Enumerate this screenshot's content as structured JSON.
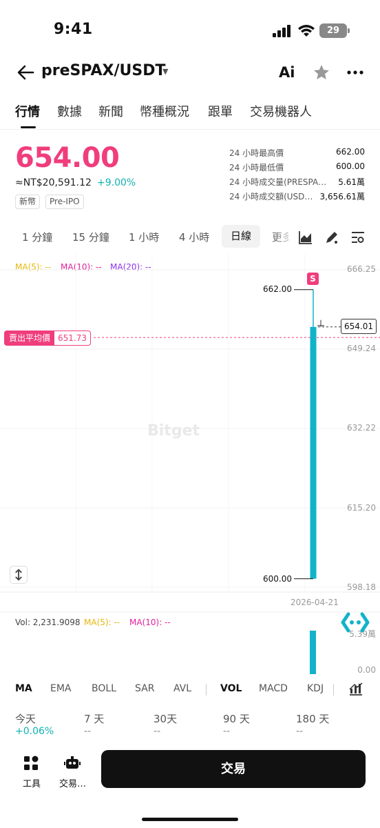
{
  "status": {
    "time": "9:41",
    "battery": "29"
  },
  "header": {
    "title": "preSPAX/USDT",
    "ai_label": "Ai"
  },
  "tabs": [
    "行情",
    "數據",
    "新聞",
    "幣種概況",
    "跟單",
    "交易機器人"
  ],
  "price": {
    "last": "654.00",
    "fiat": "≈NT$20,591.12",
    "change": "+9.00%",
    "tags": [
      "新幣",
      "Pre-IPO"
    ]
  },
  "stats": [
    {
      "label": "24 小時最高價",
      "value": "662.00"
    },
    {
      "label": "24 小時最低價",
      "value": "600.00"
    },
    {
      "label": "24 小時成交量(PRESPA…",
      "value": "5.61萬"
    },
    {
      "label": "24 小時成交額(USD…",
      "value": "3,656.61萬"
    }
  ],
  "timeframes": [
    "1 分鐘",
    "15 分鐘",
    "1 小時",
    "4 小時"
  ],
  "timeframe_active": "日線",
  "timeframe_more": "更多",
  "ma_legend": {
    "ma5": "MA(5): --",
    "ma10": "MA(10): --",
    "ma20": "MA(20): --"
  },
  "chart": {
    "axis_labels": [
      "666.25",
      "649.24",
      "632.22",
      "615.20",
      "598.18"
    ],
    "high_label": "662.00",
    "low_label": "600.00",
    "last_price_box": "654.01",
    "sell_avg_label": "賣出平均價",
    "sell_avg_value": "651.73",
    "signal_marker": "S",
    "watermark": "Bitget",
    "date": "2026-04-21"
  },
  "chart_data": {
    "type": "candlestick",
    "x": [
      "2026-04-21"
    ],
    "open": [
      600.0
    ],
    "high": [
      662.0
    ],
    "low": [
      600.0
    ],
    "close": [
      654.0
    ],
    "ylim": [
      598.18,
      666.25
    ],
    "y_ticks": [
      666.25,
      649.24,
      632.22,
      615.2,
      598.18
    ],
    "reference_lines": [
      {
        "name": "賣出平均價",
        "value": 651.73
      },
      {
        "name": "last",
        "value": 654.01
      }
    ],
    "volume": {
      "values": [
        56100
      ],
      "ylim": [
        0,
        53900
      ],
      "y_ticks": [
        "5.39萬",
        "0.00"
      ]
    },
    "colors": {
      "up": "#12b3c8",
      "sell_line": "#f03d7c"
    }
  },
  "volume": {
    "legend": "Vol: 2,231.9098",
    "ma5": "MA(5): --",
    "ma10": "MA(10): --",
    "axis_top": "5.39萬",
    "axis_bottom": "0.00"
  },
  "indicators": [
    "MA",
    "EMA",
    "BOLL",
    "SAR",
    "AVL",
    "VOL",
    "MACD",
    "KDJ"
  ],
  "performance": [
    {
      "label": "今天",
      "value": "+0.06%"
    },
    {
      "label": "7 天",
      "value": "--"
    },
    {
      "label": "30天",
      "value": "--"
    },
    {
      "label": "90 天",
      "value": "--"
    },
    {
      "label": "180 天",
      "value": "--"
    }
  ],
  "bottom": {
    "tools_label": "工具",
    "bots_label": "交易…",
    "trade_label": "交易"
  },
  "colors": {
    "accent_red": "#f03d7c",
    "accent_teal": "#12b3c8",
    "up_green": "#12b3b1"
  }
}
